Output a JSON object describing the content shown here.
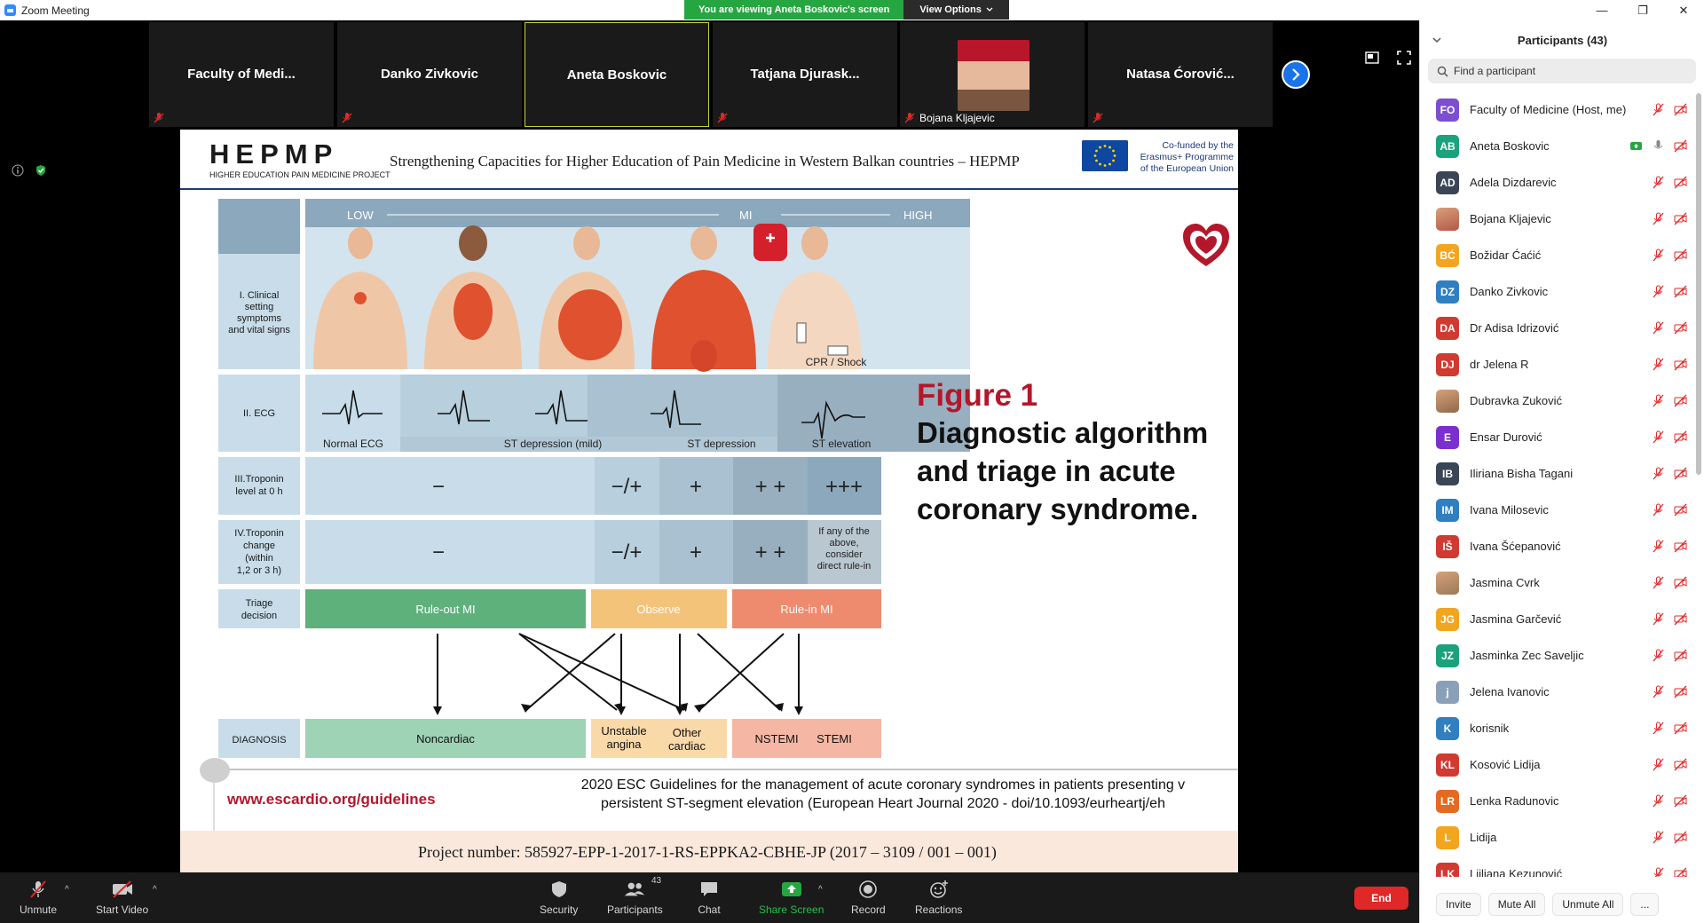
{
  "window": {
    "title": "Zoom Meeting",
    "minimize": "—",
    "maximize": "❐",
    "close": "✕"
  },
  "share_banner": {
    "text": "You are viewing Aneta Boskovic's screen",
    "view_options": "View Options"
  },
  "video_strip": [
    {
      "name": "Faculty  of  Medi...",
      "muted": true
    },
    {
      "name": "Danko Zivkovic",
      "muted": true
    },
    {
      "name": "Aneta Boskovic",
      "muted": false,
      "active": true
    },
    {
      "name": "Tatjana  Djurask...",
      "muted": true
    },
    {
      "name": "Bojana Kljajevic",
      "muted": true,
      "photo": true
    },
    {
      "name": "Natasa  Ćorović...",
      "muted": true
    }
  ],
  "slide": {
    "logo": "HEPMP",
    "logo_sub": "HIGHER EDUCATION PAIN MEDICINE PROJECT",
    "title": "Strengthening Capacities for Higher Education of Pain Medicine in Western Balkan countries – HEPMP",
    "cofunded": [
      "Co-funded by the",
      "Erasmus+ Programme",
      "of the European Union"
    ],
    "figure_label": "Figure 1",
    "figure_caption": "Diagnostic algorithm and triage in acute coronary syndrome.",
    "url": "www.escardio.org/guidelines",
    "citation_line1": "2020 ESC Guidelines for the management of acute coronary syndromes in patients presenting v",
    "citation_line2": "persistent ST-segment elevation (European Heart Journal 2020 - doi/10.1093/eurheartj/eh",
    "project": "Project number:   585927-EPP-1-2017-1-RS-EPPKA2-CBHE-JP (2017 – 3109 / 001 – 001)",
    "diagram": {
      "scale": [
        "LOW",
        "MI",
        "HIGH"
      ],
      "rows": [
        {
          "label": [
            "I. Clinical",
            "setting",
            "symptoms",
            "and vital signs"
          ]
        },
        {
          "label": [
            "II. ECG"
          ]
        },
        {
          "label": [
            "III.Troponin",
            "level at 0 h"
          ]
        },
        {
          "label": [
            "IV.Troponin",
            "change",
            "(within",
            "1,2 or 3 h)"
          ]
        },
        {
          "label": [
            "Triage",
            "decision"
          ]
        },
        {
          "label": [
            "DIAGNOSIS"
          ]
        }
      ],
      "cpr": "CPR / Shock",
      "ecg_labels": [
        "Normal ECG",
        "ST depression (mild)",
        "ST depression",
        "ST elevation"
      ],
      "troponin0": [
        "−",
        "−/+",
        "+",
        "+ +",
        "+++"
      ],
      "troponin_change": [
        "−",
        "−/+",
        "+",
        "+ +"
      ],
      "troponin_note": [
        "If any of the",
        "above,",
        "consider",
        "direct rule-in"
      ],
      "triage": [
        "Rule-out MI",
        "Observe",
        "Rule-in MI"
      ],
      "diagnosis": [
        "Noncardiac",
        "Unstable",
        "angina",
        "Other",
        "cardiac",
        "NSTEMI",
        "STEMI"
      ]
    }
  },
  "panel": {
    "title": "Participants (43)",
    "search_placeholder": "Find a participant",
    "participants": [
      {
        "initials": "FO",
        "name": "Faculty of Medicine (Host, me)",
        "color": "#7b4fcf"
      },
      {
        "initials": "AB",
        "name": "Aneta Boskovic",
        "color": "#1aa27c",
        "sharing": true
      },
      {
        "initials": "AD",
        "name": "Adela Dizdarevic",
        "color": "#3a4656"
      },
      {
        "initials": "",
        "name": "Bojana Kljajevic",
        "color": "#b4574a",
        "photo": true
      },
      {
        "initials": "BĆ",
        "name": "Božidar Ćaćić",
        "color": "#f2a51f"
      },
      {
        "initials": "DZ",
        "name": "Danko Zivkovic",
        "color": "#2f7fc1"
      },
      {
        "initials": "DA",
        "name": "Dr Adisa Idrizović",
        "color": "#d03a31"
      },
      {
        "initials": "DJ",
        "name": "dr Jelena R",
        "color": "#d03a31"
      },
      {
        "initials": "",
        "name": "Dubravka Zuković",
        "color": "#8f6a4a",
        "photo": true
      },
      {
        "initials": "E",
        "name": "Ensar Durović",
        "color": "#7b2fcf"
      },
      {
        "initials": "IB",
        "name": "Iliriana Bisha Tagani",
        "color": "#3a4656"
      },
      {
        "initials": "IM",
        "name": "Ivana Milosevic",
        "color": "#2f7fc1"
      },
      {
        "initials": "IŠ",
        "name": "Ivana Šćepanović",
        "color": "#d03a31"
      },
      {
        "initials": "",
        "name": "Jasmina Cvrk",
        "color": "#9a7a5a",
        "photo": true
      },
      {
        "initials": "JG",
        "name": "Jasmina Garčević",
        "color": "#f2a51f"
      },
      {
        "initials": "JZ",
        "name": "Jasminka Zec Saveljic",
        "color": "#1aa27c"
      },
      {
        "initials": "j",
        "name": "Jelena Ivanovic",
        "color": "#8aa0b8"
      },
      {
        "initials": "K",
        "name": "korisnik",
        "color": "#2f7fc1"
      },
      {
        "initials": "KL",
        "name": "Kosović Lidija",
        "color": "#d03a31"
      },
      {
        "initials": "LR",
        "name": "Lenka Radunovic",
        "color": "#e46a1f"
      },
      {
        "initials": "L",
        "name": "Lidija",
        "color": "#f2a51f"
      },
      {
        "initials": "LK",
        "name": "Liiliana Kezunović",
        "color": "#d03a31"
      }
    ],
    "invite": "Invite",
    "mute_all": "Mute All",
    "unmute_all": "Unmute All",
    "more": "..."
  },
  "toolbar": {
    "unmute": "Unmute",
    "start_video": "Start Video",
    "security": "Security",
    "participants": "Participants",
    "participants_count": "43",
    "chat": "Chat",
    "share_screen": "Share Screen",
    "record": "Record",
    "reactions": "Reactions",
    "end": "End"
  },
  "colors": {
    "accent": "#2d8cff",
    "share_green": "#26a641",
    "end_red": "#e02828",
    "brand_red": "#b3172b"
  }
}
